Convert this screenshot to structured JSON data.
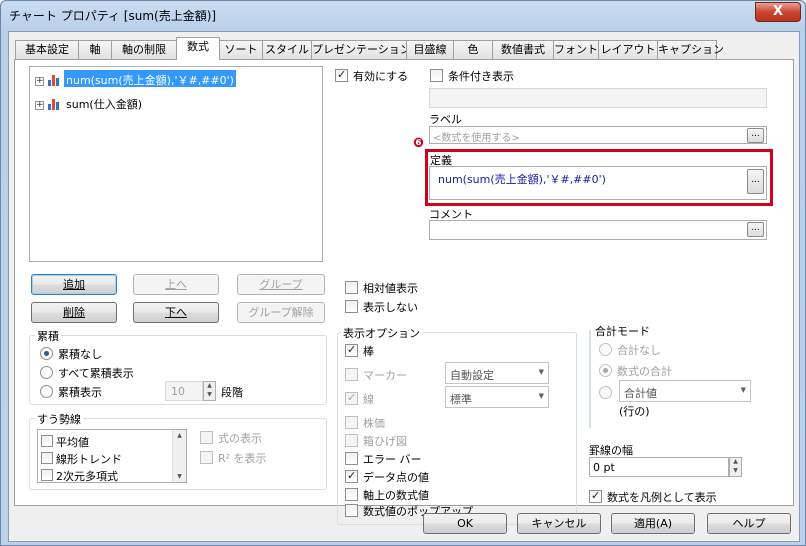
{
  "window": {
    "title": "チャート プロパティ [sum(売上金額)]",
    "close_label": "X"
  },
  "tabs": [
    {
      "label": "基本設定"
    },
    {
      "label": "軸"
    },
    {
      "label": "軸の制限"
    },
    {
      "label": "数式",
      "active": true
    },
    {
      "label": "ソート"
    },
    {
      "label": "スタイル"
    },
    {
      "label": "プレゼンテーション"
    },
    {
      "label": "目盛線"
    },
    {
      "label": "色"
    },
    {
      "label": "数値書式"
    },
    {
      "label": "フォント"
    },
    {
      "label": "レイアウト"
    },
    {
      "label": "キャプション"
    }
  ],
  "expressions": {
    "items": [
      {
        "expander": "+",
        "label": "num(sum(売上金額),'￥#,##0')",
        "selected": true
      },
      {
        "expander": "+",
        "label": "sum(仕入金額)",
        "selected": false
      }
    ]
  },
  "list_buttons": {
    "add": "追加",
    "up": "上へ",
    "group": "グループ",
    "delete": "削除",
    "down": "下へ",
    "ungroup": "グループ解除"
  },
  "accumulation": {
    "title": "累積",
    "none": "累積なし",
    "all": "すべて累積表示",
    "show": "累積表示",
    "steps_value": "10",
    "steps_label": "段階"
  },
  "trendlines": {
    "title": "すう勢線",
    "items": [
      "平均値",
      "線形トレンド",
      "2次元多項式"
    ],
    "show_equation": "式の表示",
    "show_r2": "R² を表示"
  },
  "enable": {
    "label": "有効にする",
    "checked": true
  },
  "conditional": {
    "label": "条件付き表示",
    "checked": false
  },
  "label_field": {
    "title": "ラベル",
    "placeholder": "<数式を使用する>"
  },
  "definition": {
    "title": "定義",
    "value": "num(sum(売上金額),'￥#,##0')",
    "marker": "❻",
    "highlight_color": "#d0021b"
  },
  "comment": {
    "title": "コメント"
  },
  "relative": {
    "label": "相対値表示"
  },
  "invisible": {
    "label": "表示しない"
  },
  "display_options": {
    "title": "表示オプション",
    "bar": "棒",
    "marker": "マーカー",
    "marker_select": "自動設定",
    "line": "線",
    "line_select": "標準",
    "stock": "株価",
    "box": "箱ひげ図",
    "error": "エラー バー",
    "values_on_data": "データ点の値",
    "text_on_axis": "軸上の数式値",
    "popup": "数式値のポップアップ"
  },
  "total_mode": {
    "title": "合計モード",
    "none": "合計なし",
    "sum_of_rows": "数式の合計",
    "select_value": "合計値",
    "of_rows": "(行の)"
  },
  "border_width": {
    "title": "罫線の幅",
    "value": "0 pt"
  },
  "use_as_legend": {
    "label": "数式を凡例として表示",
    "checked": true
  },
  "footer": {
    "ok": "OK",
    "cancel": "キャンセル",
    "apply": "適用(A)",
    "help": "ヘルプ"
  }
}
